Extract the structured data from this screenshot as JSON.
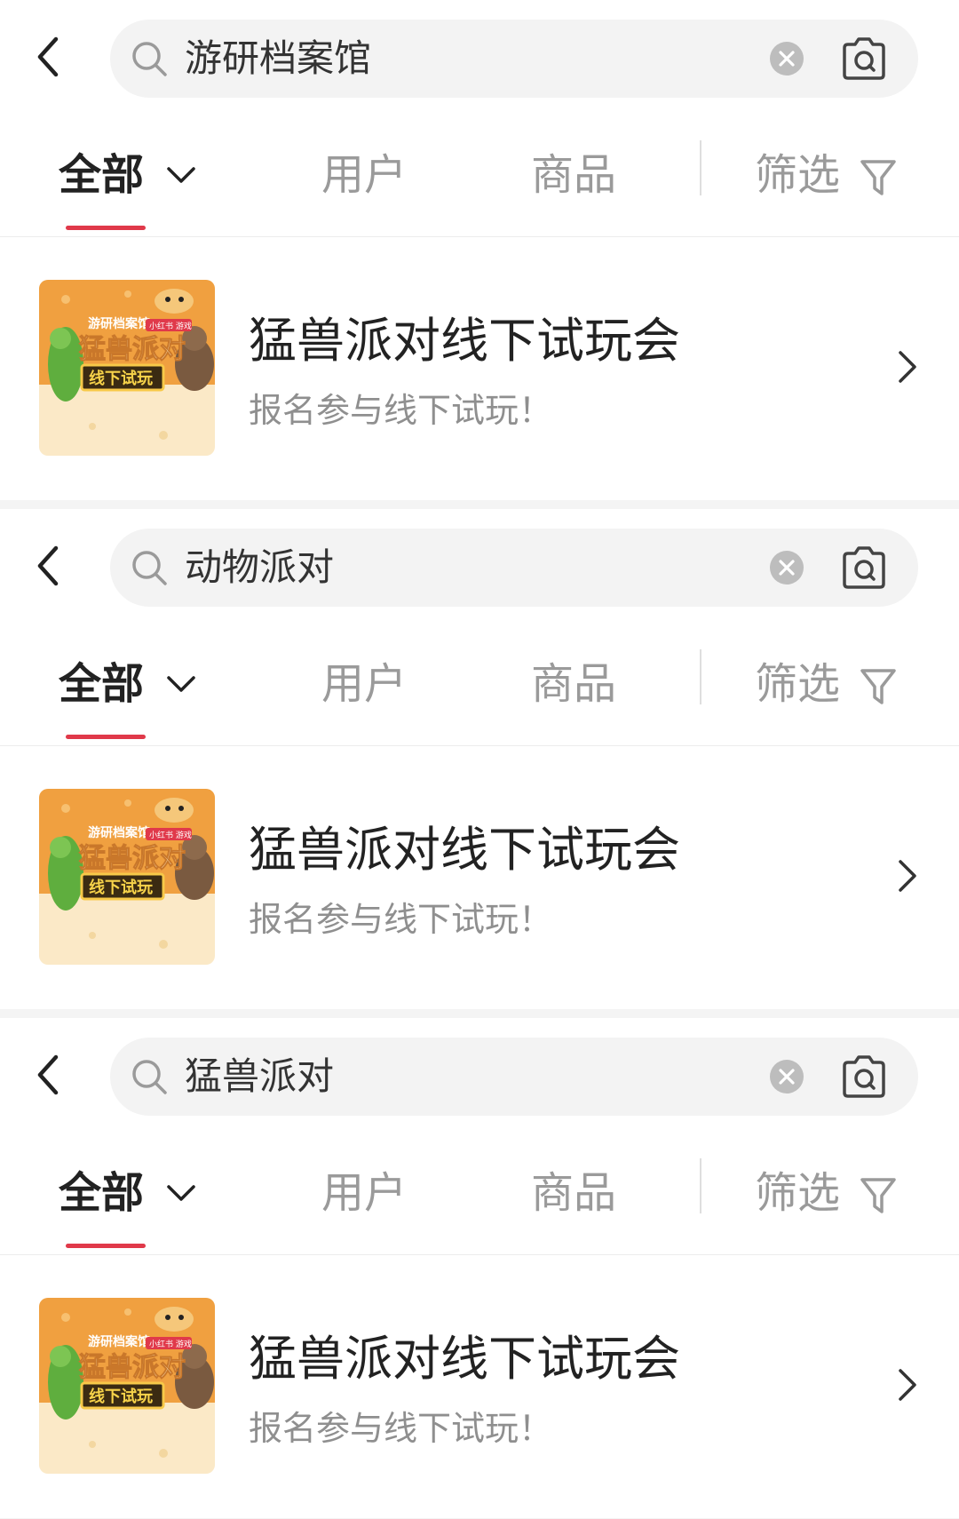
{
  "panels": [
    {
      "query": "游研档案馆",
      "tabs": {
        "all": "全部",
        "users": "用户",
        "goods": "商品",
        "filter": "筛选"
      },
      "result": {
        "title": "猛兽派对线下试玩会",
        "subtitle": "报名参与线下试玩！"
      }
    },
    {
      "query": "动物派对",
      "tabs": {
        "all": "全部",
        "users": "用户",
        "goods": "商品",
        "filter": "筛选"
      },
      "result": {
        "title": "猛兽派对线下试玩会",
        "subtitle": "报名参与线下试玩！"
      }
    },
    {
      "query": "猛兽派对",
      "tabs": {
        "all": "全部",
        "users": "用户",
        "goods": "商品",
        "filter": "筛选"
      },
      "result": {
        "title": "猛兽派对线下试玩会",
        "subtitle": "报名参与线下试玩！"
      }
    }
  ],
  "thumbnail": {
    "brand_text": "游研档案馆",
    "title_text": "猛兽派对",
    "badge_text": "线下试玩",
    "corner_tag": "小红书 游戏"
  },
  "icons": {
    "back": "chevron-left-icon",
    "search": "magnifier-icon",
    "clear": "close-circle-icon",
    "camera": "camera-search-icon",
    "dropdown": "chevron-down-icon",
    "filter": "funnel-icon",
    "row_arrow": "chevron-right-icon"
  },
  "colors": {
    "active_underline": "#e0394a",
    "thumb_orange": "#f0a040",
    "thumb_cream": "#fbe9c7"
  }
}
